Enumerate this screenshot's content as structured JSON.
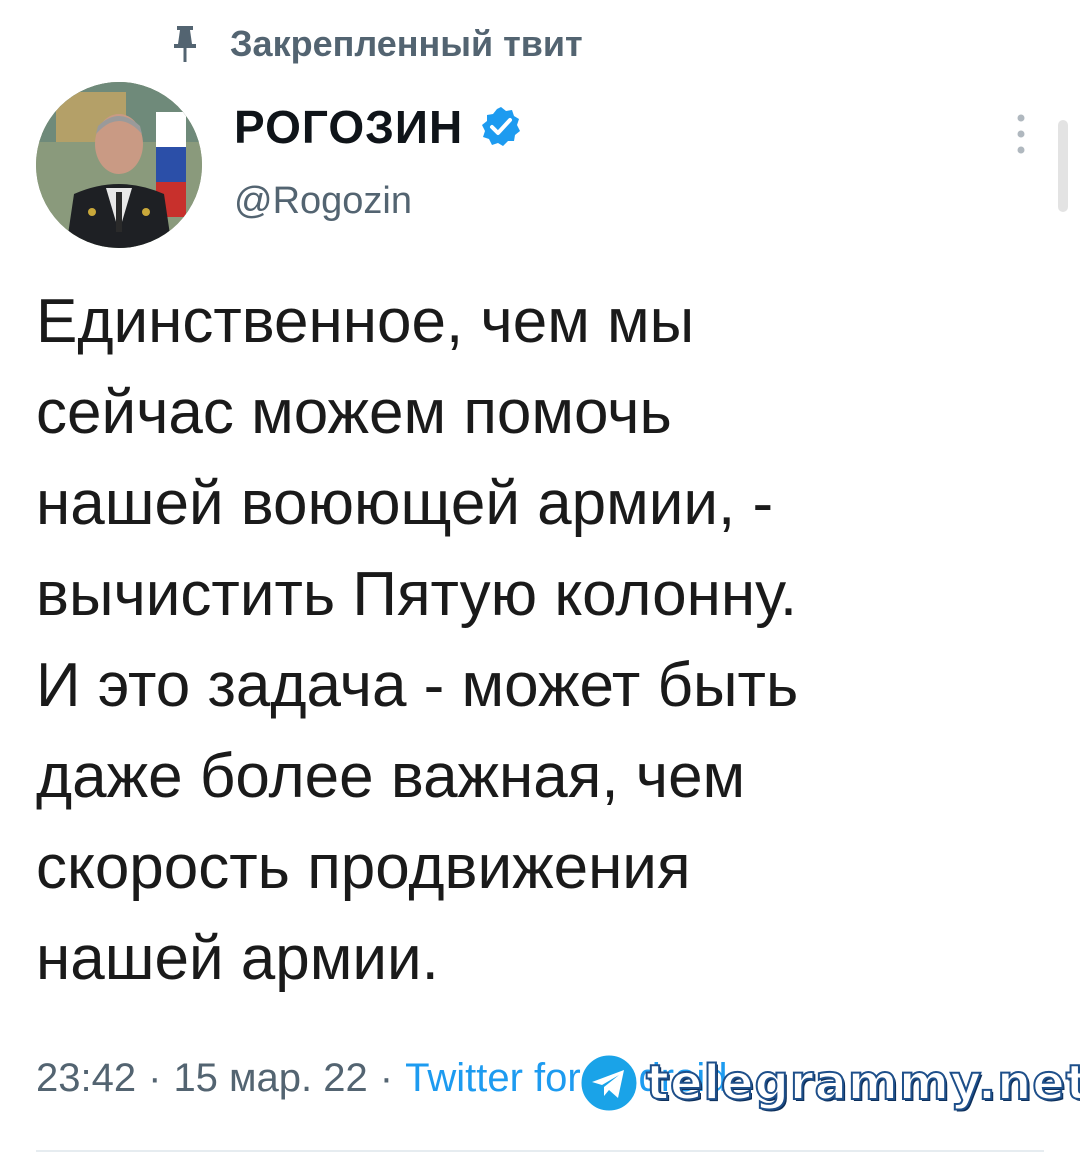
{
  "pinned": {
    "label": "Закрепленный твит",
    "icon": "pin-icon"
  },
  "author": {
    "name": "РОГОЗИН",
    "handle": "@Rogozin",
    "verified": true,
    "verified_color": "#1d9bf0"
  },
  "tweet": {
    "text": "Единственное, чем мы\nсейчас можем помочь\nнашей воюющей армии, -\nвычистить Пятую колонну.\nИ это задача - может быть\nдаже более важная, чем\nскорость продвижения\nнашей армии."
  },
  "meta": {
    "time": "23:42",
    "separator": "·",
    "date": "15 мар. 22",
    "source": "Twitter for Android"
  },
  "watermark": {
    "text": "telegrammy.net"
  },
  "colors": {
    "secondary_text": "#536471",
    "link": "#1d9bf0",
    "primary_text": "#0f1419"
  }
}
